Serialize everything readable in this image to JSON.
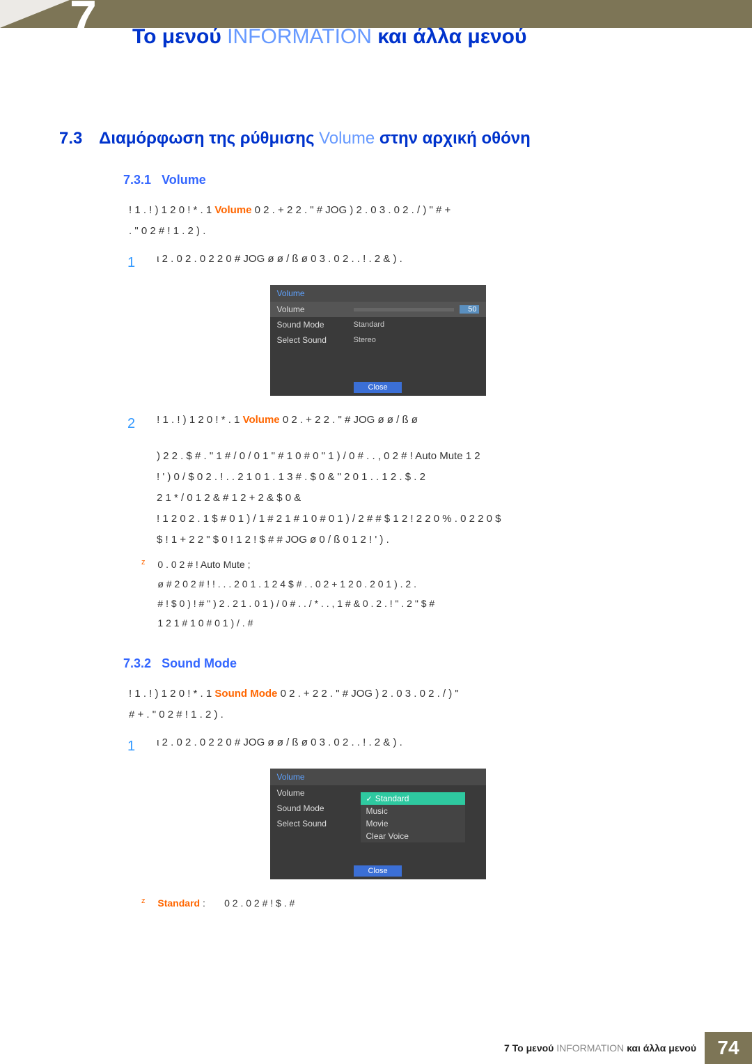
{
  "chapter": {
    "number_glyph": "7",
    "title_prefix": "Το μενού",
    "title_mid": "INFORMATION",
    "title_suffix": "και άλλα μενού"
  },
  "section": {
    "num": "7.3",
    "prefix": "Διαμόρφωση της ρύθμισης",
    "mid": "Volume",
    "suffix": "στην αρχική οθόνη"
  },
  "sub731": {
    "num": "7.3.1",
    "title": "Volume",
    "intro_a": "! 1 . !   ) 1 2 0  ! * .  1",
    "intro_vol": "Volume",
    "intro_b": "0 2 .   +   2 2 . \"   #   JOG ) 2 . 0   3 .   0 2 . /   ) \"   #   +",
    "intro_c": ". \"   0   2   # !   1 . 2     )   .",
    "step1": {
      "num": "1",
      "text": "ι 2 .   0 2 .   0 2 2 0 #    JOG ø     ø / ß    ø 0   3 .   0 2 . . ! .   2 &   )   ."
    },
    "step2": {
      "num": "2",
      "text_a": "! 1 . !   ) 1 2 0  ! * .  1",
      "text_vol": "Volume",
      "text_b": "0 2 .   +   2 2 . \"   #   JOG ø     ø / ß    ø"
    },
    "block_a": ") 2   2 . $   #   . \" 1   #   / 0 / 0   1 \" # 1   0   # 0 \"   1   ) /   0 #   .    . ,   0   2   # ! Auto Mute   1 2",
    "block_b": "!   ' )   0   /   $ 0 2 . ! .   . 2     1 0   1   . 1   3   #   .   $ 0   & \"   2   0 1   . . 1 2 .   $   . 2",
    "block_c": "2   1 *   / 0 1   2 &   # 1 2   + 2 &   $ 0   &",
    "block_d": "!   1 2 0    2 . 1   $   # 0   1   ) /   1 # 2 1   #   1   0   # 0   1   ) /   2 #   #   $   1   2 ! 2 2 0 % .   0     2 2 0   $",
    "block_e": "$   !   1    +   2 2 \"  $ 0   !   1 2   ! $   #     #    JOG ø       0 / ß    0   1 2   !   ' ) .",
    "bullet_label": "0    .   0   2   # ! Auto Mute ;",
    "bullet_t1": "ø # 2   0   2   # ! ! . .   . 2    0 1   . 1   2   4 $   #   .  .   0   2   + 1 2 0 .   2   0 1   ) . 2 .",
    "bullet_t2": "#   !  $ 0 ) !  #   \"   ) 2 . 2   1   . 0   1   ) /   0 #   . .  / * .   . , 1   #    & 0    . 2   . ! \"   . 2   \"   $   #",
    "bullet_t3": "1 2   1 # 1   0   # 0   1   ) / . #"
  },
  "osd1": {
    "header": "Volume",
    "rows": [
      {
        "label": "Volume",
        "value": "50"
      },
      {
        "label": "Sound Mode",
        "value": "Standard"
      },
      {
        "label": "Select Sound",
        "value": "Stereo"
      }
    ],
    "close": "Close"
  },
  "osd2": {
    "header": "Volume",
    "rows": [
      {
        "label": "Volume",
        "value": ""
      },
      {
        "label": "Sound Mode",
        "value": ""
      },
      {
        "label": "Select Sound",
        "value": ""
      }
    ],
    "options": [
      "Standard",
      "Music",
      "Movie",
      "Clear Voice"
    ],
    "close": "Close"
  },
  "sub732": {
    "num": "7.3.2",
    "title": "Sound Mode",
    "intro_a": "! 1 . !   ) 1 2 0  ! * .  1",
    "intro_sm": "Sound Mode",
    "intro_b": "0 2 .   +   2 2 . \"   #   JOG ) 2 . 0   3 .   0 2 . /   ) \"",
    "intro_c": "#   +   . \"   0   2   # !   1 . 2     )   .",
    "step1": {
      "num": "1",
      "text": "ι 2 .   0 2 .   0 2 2 0 #    JOG ø     ø / ß    ø 0   3 .   0 2 . . ! .   2 &   )   ."
    },
    "bullet": {
      "label": "Standard",
      "sep": ":",
      "text": "0 2    .    0   2   # !   $ .   #"
    }
  },
  "footer": {
    "chapnum": "7",
    "prefix": "Το μενού",
    "mid": "INFORMATION",
    "suffix": "και άλλα μενού",
    "page": "74"
  }
}
